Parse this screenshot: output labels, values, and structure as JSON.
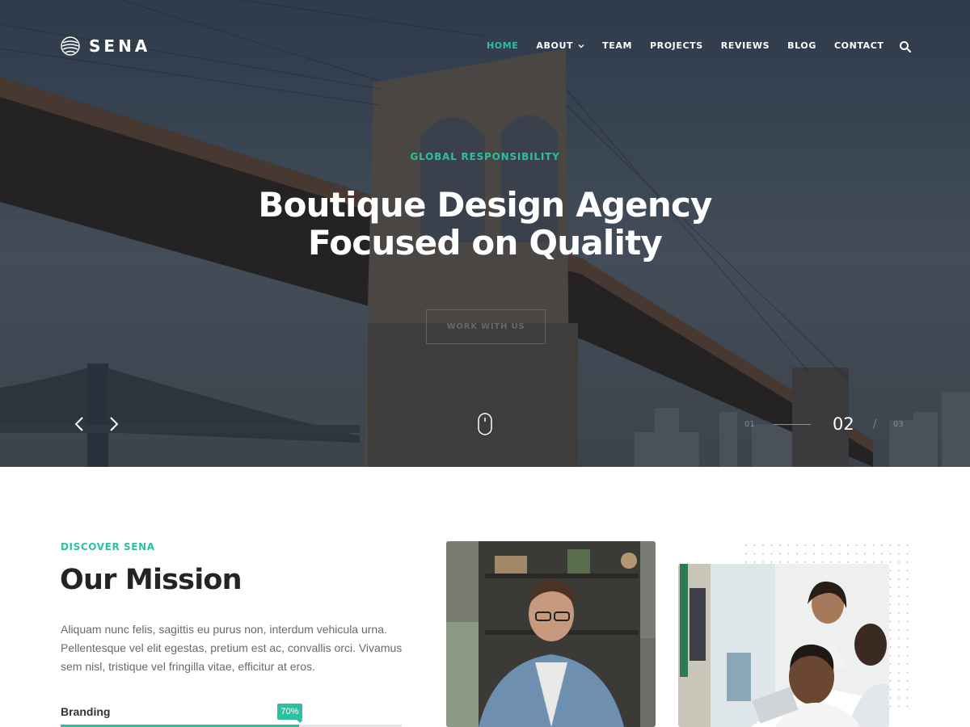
{
  "brand": {
    "name": "SENA",
    "logo_icon": "globe-stripes-icon"
  },
  "nav": {
    "items": [
      {
        "label": "HOME",
        "active": true
      },
      {
        "label": "ABOUT",
        "has_dropdown": true
      },
      {
        "label": "TEAM"
      },
      {
        "label": "PROJECTS"
      },
      {
        "label": "REVIEWS"
      },
      {
        "label": "BLOG"
      },
      {
        "label": "CONTACT"
      }
    ],
    "search_icon": "search-icon"
  },
  "hero": {
    "eyebrow": "GLOBAL RESPONSIBILITY",
    "headline_line1": "Boutique Design Agency",
    "headline_line2": "Focused on Quality",
    "cta_label": "WORK WITH US",
    "slides": {
      "prev": "01",
      "current": "02",
      "separator": "/",
      "next": "03"
    }
  },
  "mission": {
    "eyebrow": "DISCOVER SENA",
    "title": "Our Mission",
    "text": "Aliquam nunc felis, sagittis eu purus non, interdum vehicula urna. Pellentesque vel elit egestas, pretium est ac, convallis orci. Vivamus sem nisl, tristique vel fringilla vitae, efficitur at eros.",
    "skill": {
      "label": "Branding",
      "percent_label": "70%",
      "value": 0.7
    }
  },
  "colors": {
    "accent": "#2bc0a0",
    "heading": "#222428",
    "body_text": "#666a70"
  }
}
